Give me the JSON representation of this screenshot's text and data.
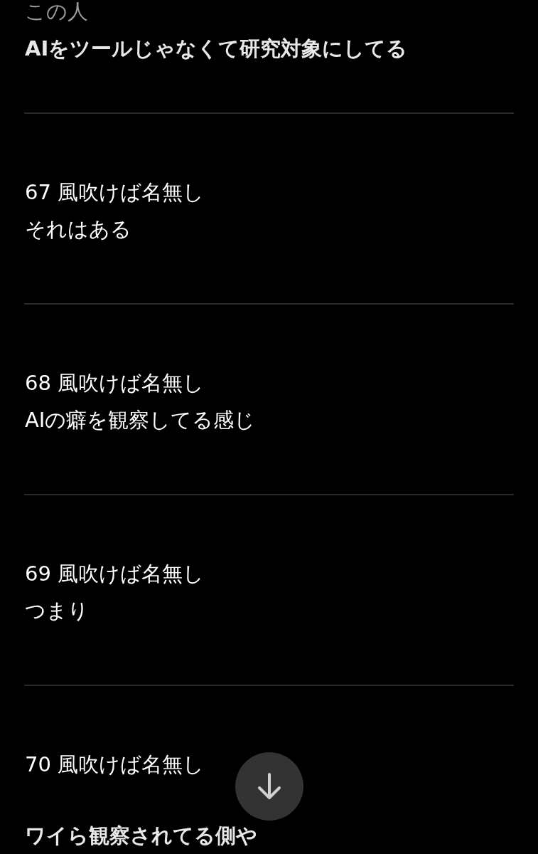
{
  "top_fragment": {
    "lines": [
      {
        "text": "この人",
        "faded": true,
        "bold": false
      },
      {
        "text": "AIをツールじゃなくて研究対象にしてる",
        "faded": false,
        "bold": true
      }
    ]
  },
  "posts": [
    {
      "number": "67",
      "author": "風吹けば名無し",
      "body": "それはある",
      "bold": false
    },
    {
      "number": "68",
      "author": "風吹けば名無し",
      "body": "AIの癖を観察してる感じ",
      "bold": false
    },
    {
      "number": "69",
      "author": "風吹けば名無し",
      "body": "つまり",
      "bold": false
    },
    {
      "number": "70",
      "author": "風吹けば名無し",
      "body": "ワイら観察されてる側や",
      "bold": true
    }
  ]
}
